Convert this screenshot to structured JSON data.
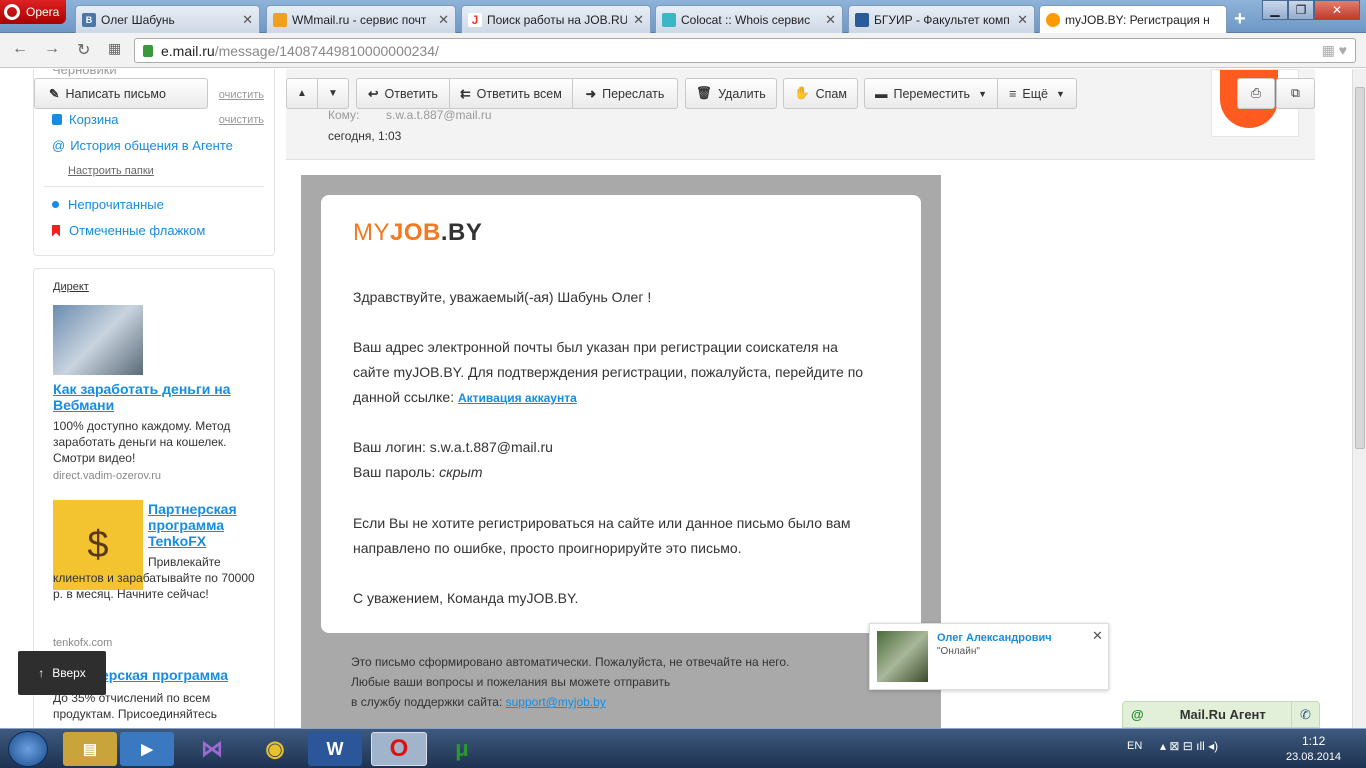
{
  "browser": {
    "app_name": "Opera",
    "tabs": [
      {
        "label": "Олег Шабунь",
        "favicon": "vk-icon"
      },
      {
        "label": "WMmail.ru - сервис почт",
        "favicon": "wmmail-icon"
      },
      {
        "label": "Поиск работы на JOB.RU",
        "favicon": "jobru-icon"
      },
      {
        "label": "Colocat :: Whois сервис",
        "favicon": "colocat-icon"
      },
      {
        "label": "БГУИР - Факультет комп",
        "favicon": "bsuir-icon"
      },
      {
        "label": "myJOB.BY: Регистрация н",
        "favicon": "mailru-icon"
      }
    ],
    "url_domain": "e.mail.ru",
    "url_path": "/message/14087449810000000234/"
  },
  "sidebar": {
    "compose_label": "Написать письмо",
    "drafts_label": "Черновики",
    "clear_label": "очистить",
    "trash_label": "Корзина",
    "trash_clear_label": "очистить",
    "history_label": "История общения в Агенте",
    "setup_folders_label": "Настроить папки",
    "unread_label": "Непрочитанные",
    "flagged_label": "Отмеченные флажком"
  },
  "ads": {
    "direct_label": "Директ",
    "ad1": {
      "title": "Как заработать деньги на Вебмани",
      "text": "100% доступно каждому. Метод заработать деньги на кошелек. Смотри видео!",
      "domain": "direct.vadim-ozerov.ru"
    },
    "ad2": {
      "title": "Партнерская программа TenkoFX",
      "text": "Привлекайте клиентов и зарабатывайте по 70000 р. в месяц. Начните сейчас!",
      "domain": "tenkofx.com"
    },
    "ad3": {
      "title": "...ерская программа",
      "text": "До 35% отчислений по всем продуктам. Присоединяйтесь"
    },
    "up_button": "Вверх"
  },
  "toolbar": {
    "reply": "Ответить",
    "reply_all": "Ответить всем",
    "forward": "Переслать",
    "delete": "Удалить",
    "spam": "Спам",
    "move": "Переместить",
    "more": "Ещё"
  },
  "header": {
    "to_label": "Кому:",
    "to_value": "s.w.a.t.887@mail.ru",
    "date": "сегодня, 1:03"
  },
  "email": {
    "logo_my": "MY",
    "logo_job": "JOB",
    "logo_by": ".BY",
    "greeting": "Здравствуйте, уважаемый(-ая) Шабунь Олег !",
    "p1_l1": "Ваш адрес электронной почты был указан при регистрации соискателя на",
    "p1_l2": "сайте myJOB.BY. Для подтверждения регистрации, пожалуйста, перейдите по",
    "p1_l3": "данной ссылке:",
    "activation_link": "Активация аккаунта",
    "login_label": "Ваш логин:",
    "login_value": "s.w.a.t.887@mail.ru",
    "password_label": "Ваш пароль:",
    "password_value": "скрыт",
    "p3_l1": "Если Вы не хотите регистрироваться на сайте или данное письмо было вам",
    "p3_l2": "направлено по ошибке, просто проигнорируйте это письмо.",
    "signature": "С уважением, Команда myJOB.BY.",
    "footer_l1": "Это письмо сформировано автоматически. Пожалуйста, не отвечайте на него.",
    "footer_l2": "Любые ваши вопросы и пожелания вы можете отправить",
    "footer_l3": "в службу поддержки сайта:",
    "support_email": "support@myjob.by"
  },
  "notification": {
    "name": "Олег Александрович",
    "status": "\"Онлайн\""
  },
  "agent": {
    "label": "Mail.Ru Агент"
  },
  "taskbar": {
    "lang": "EN",
    "time": "1:12",
    "date": "23.08.2014"
  },
  "colors": {
    "accent": "#168de2",
    "myjob_orange": "#f47920",
    "mailru_orange": "#ff6a00"
  }
}
